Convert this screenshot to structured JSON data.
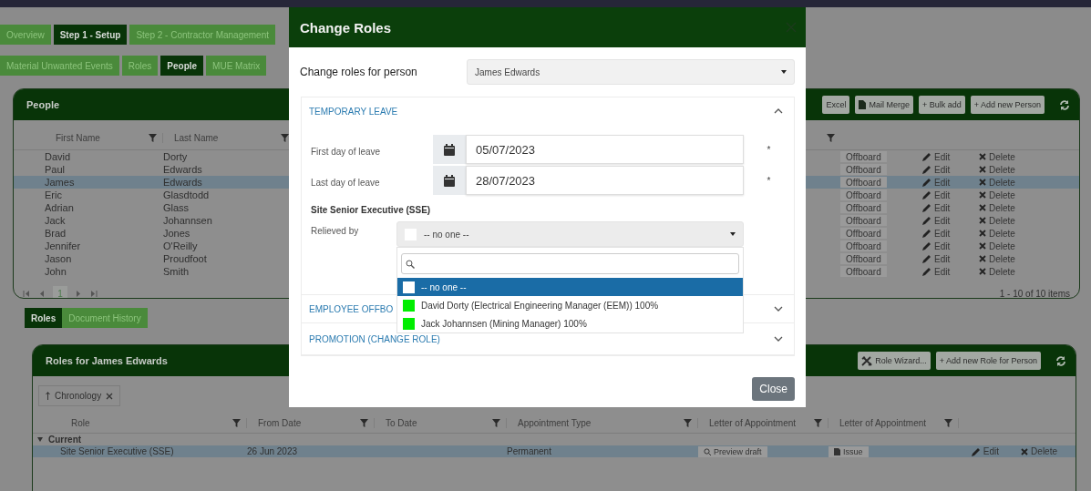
{
  "nav_tabs": [
    {
      "label": "Overview",
      "selected": false
    },
    {
      "label": "Step 1 - Setup",
      "selected": true
    },
    {
      "label": "Step 2 - Contractor Management",
      "selected": false
    }
  ],
  "sub_tabs": [
    {
      "label": "Material Unwanted Events",
      "selected": false
    },
    {
      "label": "Roles",
      "selected": false
    },
    {
      "label": "People",
      "selected": true
    },
    {
      "label": "MUE Matrix",
      "selected": false
    }
  ],
  "people_panel": {
    "title": "People",
    "toolbar": [
      "Excel",
      "Mail Merge",
      "+ Bulk add",
      "+ Add new Person"
    ],
    "columns": [
      "First Name",
      "Last Name"
    ],
    "rows": [
      {
        "first_name": "David",
        "last_name": "Dorty",
        "selected": false,
        "offboard": "Offboard",
        "edit": "Edit",
        "delete": "Delete"
      },
      {
        "first_name": "Paul",
        "last_name": "Edwards",
        "selected": false,
        "offboard": "Offboard",
        "edit": "Edit",
        "delete": "Delete"
      },
      {
        "first_name": "James",
        "last_name": "Edwards",
        "selected": true,
        "offboard": "Offboard",
        "edit": "Edit",
        "delete": "Delete"
      },
      {
        "first_name": "Eric",
        "last_name": "Glasdtodd",
        "selected": false,
        "offboard": "Offboard",
        "edit": "Edit",
        "delete": "Delete"
      },
      {
        "first_name": "Adrian",
        "last_name": "Glass",
        "selected": false,
        "offboard": "Offboard",
        "edit": "Edit",
        "delete": "Delete"
      },
      {
        "first_name": "Jack",
        "last_name": "Johannsen",
        "selected": false,
        "offboard": "Offboard",
        "edit": "Edit",
        "delete": "Delete"
      },
      {
        "first_name": "Brad",
        "last_name": "Jones",
        "selected": false,
        "offboard": "Offboard",
        "edit": "Edit",
        "delete": "Delete"
      },
      {
        "first_name": "Jennifer",
        "last_name": "O'Reilly",
        "selected": false,
        "offboard": "Offboard",
        "edit": "Edit",
        "delete": "Delete"
      },
      {
        "first_name": "Jason",
        "last_name": "Proudfoot",
        "selected": false,
        "offboard": "Offboard",
        "edit": "Edit",
        "delete": "Delete"
      },
      {
        "first_name": "John",
        "last_name": "Smith",
        "selected": false,
        "offboard": "Offboard",
        "edit": "Edit",
        "delete": "Delete"
      }
    ],
    "pager": {
      "page": "1",
      "summary": "1 - 10 of 10 items"
    }
  },
  "detail_tabs": [
    {
      "label": "Roles",
      "selected": true
    },
    {
      "label": "Document History",
      "selected": false
    }
  ],
  "roles_panel": {
    "title": "Roles for James Edwards",
    "toolbar": [
      "Role Wizard...",
      "+ Add new Role for Person"
    ],
    "sort_chip": "Chronology",
    "columns": [
      "Role",
      "From Date",
      "To Date",
      "Appointment Type",
      "Letter of Appointment",
      "Letter of Appointment"
    ],
    "group": {
      "label": "Current",
      "expanded": true
    },
    "rows": [
      {
        "role": "Site Senior Executive (SSE)",
        "from_date": "26 Jun 2023",
        "appointment_type": "Permanent",
        "letter_draft": "Preview draft",
        "letter_issue": "Issue",
        "edit": "Edit",
        "delete": "Delete",
        "selected": true
      }
    ]
  },
  "modal": {
    "title": "Change Roles",
    "person_label": "Change roles for person",
    "person_value": "James Edwards",
    "sections": [
      {
        "title": "TEMPORARY LEAVE",
        "expanded": true
      },
      {
        "title": "EMPLOYEE OFFBO",
        "expanded": false
      },
      {
        "title": "PROMOTION (CHANGE ROLE)",
        "expanded": false
      }
    ],
    "leave_fields": [
      {
        "label": "First day of leave",
        "value": "05/07/2023",
        "required_mark": "*"
      },
      {
        "label": "Last day of leave",
        "value": "28/07/2023",
        "required_mark": "*"
      }
    ],
    "role_heading": "Site Senior Executive (SSE)",
    "relieved_by": {
      "label": "Relieved by",
      "value": "-- no one --",
      "color": "#ffffff"
    },
    "options": [
      {
        "label": "-- no one --",
        "color": "#ffffff",
        "selected": true
      },
      {
        "label": "David Dorty (Electrical Engineering Manager (EEM)) 100%",
        "color": "#00ee00",
        "selected": false
      },
      {
        "label": "Jack Johannsen (Mining Manager) 100%",
        "color": "#00ee00",
        "selected": false
      }
    ],
    "close_button": "Close"
  }
}
